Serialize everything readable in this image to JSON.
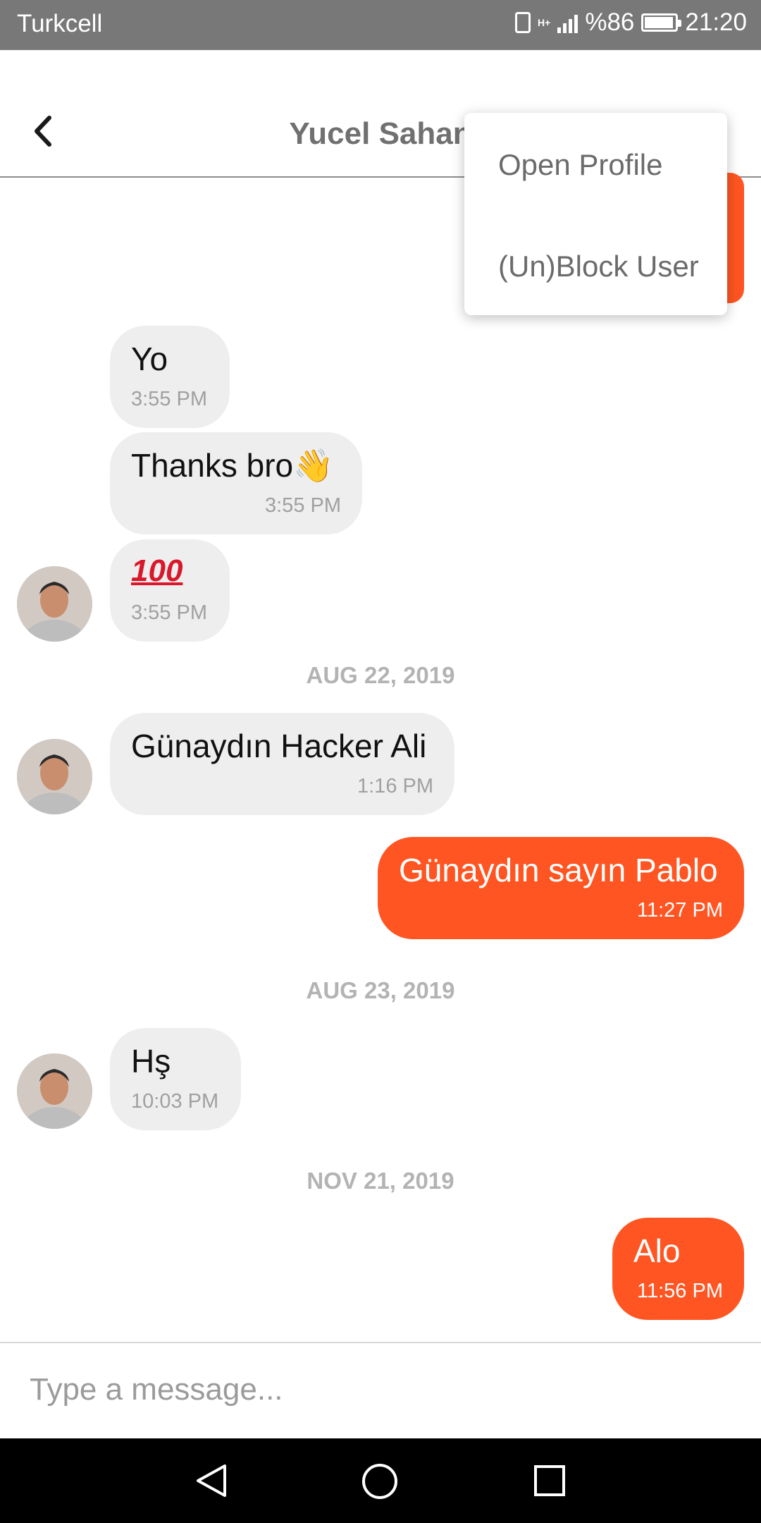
{
  "status_bar": {
    "carrier": "Turkcell",
    "network_type": "H+",
    "battery_percent_text": "%86",
    "battery_level": 0.86,
    "time": "21:20"
  },
  "header": {
    "title": "Yucel Sahan"
  },
  "menu": {
    "items": [
      {
        "label": "Open Profile"
      },
      {
        "label": "(Un)Block User"
      }
    ]
  },
  "messages": [
    {
      "direction": "in",
      "text": "Yo",
      "time": "3:55 PM"
    },
    {
      "direction": "in",
      "text": "Thanks bro",
      "emoji": "waving-hand",
      "time": "3:55 PM"
    },
    {
      "direction": "in",
      "text": "100",
      "emoji": "hundred-points",
      "time": "3:55 PM"
    },
    {
      "date": "AUG 22, 2019"
    },
    {
      "direction": "in",
      "text": "Günaydın Hacker Ali",
      "time": "1:16 PM"
    },
    {
      "direction": "out",
      "text": "Günaydın sayın Pablo",
      "time": "11:27 PM"
    },
    {
      "date": "AUG 23, 2019"
    },
    {
      "direction": "in",
      "text": "Hş",
      "time": "10:03 PM"
    },
    {
      "date": "NOV 21, 2019"
    },
    {
      "direction": "out",
      "text": "Alo",
      "time": "11:56 PM"
    }
  ],
  "composer": {
    "placeholder": "Type a message..."
  },
  "colors": {
    "outgoing_bubble": "#ff5522",
    "incoming_bubble": "#eeeeee",
    "status_bar": "#787878"
  }
}
